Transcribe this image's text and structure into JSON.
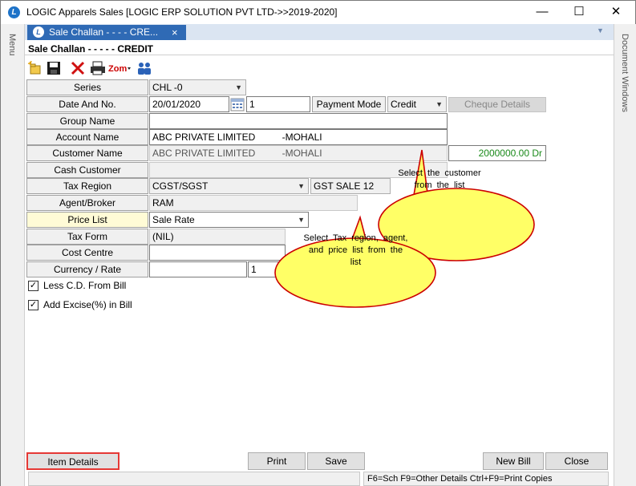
{
  "window": {
    "title": "LOGIC Apparels Sales  [LOGIC ERP SOLUTION PVT LTD->>2019-2020]",
    "app_icon_letter": "L"
  },
  "rails": {
    "left_label": "Menu",
    "right_label": "Document Windows"
  },
  "tab": {
    "label": "Sale Challan  -  - - -  CRE...",
    "close": "×"
  },
  "form": {
    "header": "Sale Challan  -  - - -  - CREDIT"
  },
  "toolbar": {
    "icons": [
      "new-icon",
      "save-icon",
      "delete-icon",
      "print-icon",
      "zoom-icon",
      "users-icon"
    ],
    "zoom_label": "Zom"
  },
  "fields": {
    "series": {
      "label": "Series",
      "value": "CHL -0"
    },
    "date": {
      "label": "Date And No.",
      "date": "20/01/2020",
      "number": "1"
    },
    "payment_mode": {
      "label": "Payment Mode",
      "value": "Credit"
    },
    "cheque_details": "Cheque Details",
    "group_name": {
      "label": "Group Name",
      "value": ""
    },
    "account_name": {
      "label": "Account Name",
      "value": "ABC PRIVATE LIMITED          -MOHALI"
    },
    "customer_name": {
      "label": "Customer Name",
      "value": "ABC PRIVATE LIMITED          -MOHALI",
      "balance": "2000000.00 Dr"
    },
    "cash_customer": {
      "label": "Cash Customer",
      "value": ""
    },
    "tax_region": {
      "label": "Tax Region",
      "value": "CGST/SGST",
      "sale_type": "GST SALE 12"
    },
    "agent": {
      "label": "Agent/Broker",
      "value": "RAM"
    },
    "price_list": {
      "label": "Price List",
      "value": "Sale Rate"
    },
    "tax_form": {
      "label": "Tax Form",
      "value": "(NIL)"
    },
    "cost_centre": {
      "label": "Cost Centre",
      "value": ""
    },
    "currency": {
      "label": "Currency / Rate",
      "value": "",
      "rate": "1"
    }
  },
  "checkboxes": [
    {
      "label": "Less C.D. From Bill",
      "checked": true
    },
    {
      "label": "Add Excise(%) in Bill",
      "checked": true
    }
  ],
  "balloons": [
    {
      "text": "Select  the  customer  from  the  list"
    },
    {
      "text": "Select  Tax  region,  agent,  and  price  list  from  the  list"
    }
  ],
  "buttons": {
    "item_details": "Item Details",
    "print": "Print",
    "save": "Save",
    "new_bill": "New Bill",
    "close": "Close"
  },
  "status": {
    "shortcuts": "F6=Sch  F9=Other Details  Ctrl+F9=Print Copies"
  },
  "colors": {
    "tab_active": "#2f6ab5",
    "highlight_border": "#e53935",
    "balloon_fill": "#ffff66",
    "balloon_border": "#cc0000",
    "balance_text": "#1a8a1a"
  }
}
